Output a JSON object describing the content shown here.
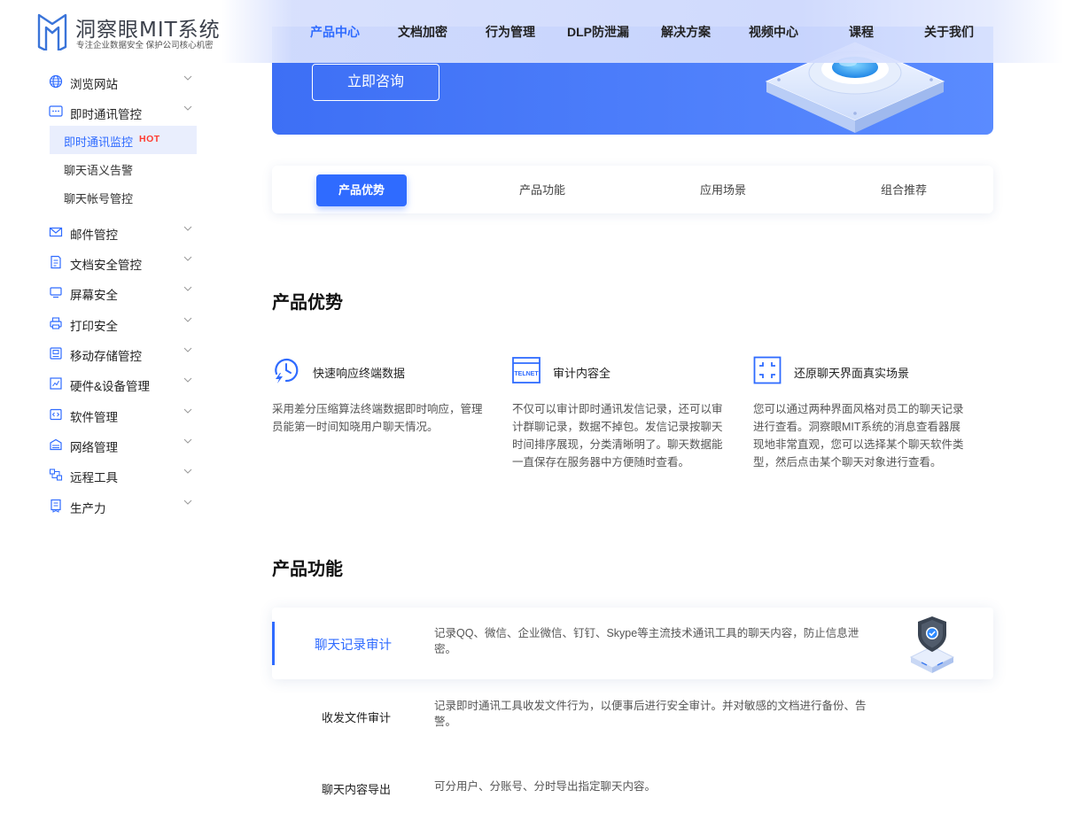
{
  "header": {
    "logo_title": "洞察眼MIT系统",
    "logo_subtitle": "专注企业数据安全 保护公司核心机密",
    "nav": [
      {
        "label": "产品中心",
        "active": true
      },
      {
        "label": "文档加密"
      },
      {
        "label": "行为管理"
      },
      {
        "label": "DLP防泄漏"
      },
      {
        "label": "解决方案"
      },
      {
        "label": "视频中心"
      },
      {
        "label": "课程"
      },
      {
        "label": "关于我们"
      }
    ]
  },
  "sidebar": {
    "items": [
      {
        "label": "浏览网站",
        "icon": "globe-icon"
      },
      {
        "label": "即时通讯管控",
        "icon": "chat-icon",
        "expanded": true
      },
      {
        "label": "邮件管控",
        "icon": "mail-icon"
      },
      {
        "label": "文档安全管控",
        "icon": "document-icon"
      },
      {
        "label": "屏幕安全",
        "icon": "monitor-icon"
      },
      {
        "label": "打印安全",
        "icon": "printer-icon"
      },
      {
        "label": "移动存储管控",
        "icon": "usb-storage-icon"
      },
      {
        "label": "硬件&设备管理",
        "icon": "hardware-icon"
      },
      {
        "label": "软件管理",
        "icon": "code-icon"
      },
      {
        "label": "网络管理",
        "icon": "network-icon"
      },
      {
        "label": "远程工具",
        "icon": "remote-icon"
      },
      {
        "label": "生产力",
        "icon": "productivity-icon"
      }
    ],
    "sub_items": [
      {
        "label": "即时通讯监控",
        "badge": "HOT",
        "active": true
      },
      {
        "label": "聊天语义告警"
      },
      {
        "label": "聊天帐号管控"
      }
    ]
  },
  "banner": {
    "consult_label": "立即咨询"
  },
  "tabs": [
    {
      "label": "产品优势",
      "active": true
    },
    {
      "label": "产品功能"
    },
    {
      "label": "应用场景"
    },
    {
      "label": "组合推荐"
    }
  ],
  "advantages": {
    "title": "产品优势",
    "items": [
      {
        "title": "快速响应终端数据",
        "icon": "fast-response-icon",
        "desc": "采用差分压缩算法终端数据即时响应，管理员能第一时间知晓用户聊天情况。"
      },
      {
        "title": "审计内容全",
        "icon": "telnet-icon",
        "icon_text": "TELNET",
        "desc": "不仅可以审计即时通讯发信记录，还可以审计群聊记录，数据不掉包。发信记录按聊天时间排序展现，分类清晰明了。聊天数据能一直保存在服务器中方便随时查看。"
      },
      {
        "title": "还原聊天界面真实场景",
        "icon": "restore-frame-icon",
        "desc": "您可以通过两种界面风格对员工的聊天记录进行查看。洞察眼MIT系统的消息查看器展现地非常直观，您可以选择某个聊天软件类型，然后点击某个聊天对象进行查看。"
      }
    ]
  },
  "features": {
    "title": "产品功能",
    "items": [
      {
        "name": "聊天记录审计",
        "active": true,
        "desc": "记录QQ、微信、企业微信、钉钉、Skype等主流技术通讯工具的聊天内容，防止信息泄密。"
      },
      {
        "name": "收发文件审计",
        "desc": "记录即时通讯工具收发文件行为，以便事后进行安全审计。并对敏感的文档进行备份、告警。"
      },
      {
        "name": "聊天内容导出",
        "desc": "可分用户、分账号、分时导出指定聊天内容。"
      }
    ]
  },
  "colors": {
    "accent": "#2f6bff",
    "hot": "#ff3b30",
    "banner": "#4a7bf8"
  }
}
